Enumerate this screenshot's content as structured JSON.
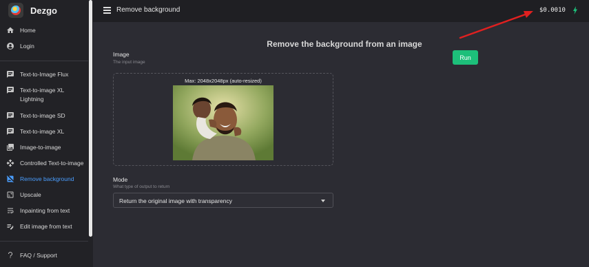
{
  "app": {
    "brand": "Dezgo"
  },
  "sidebar": {
    "items": [
      {
        "label": "Home",
        "icon": "home-icon"
      },
      {
        "label": "Login",
        "icon": "account-circle-icon"
      },
      {
        "label": "Text-to-Image Flux",
        "icon": "text-message-icon"
      },
      {
        "label": "Text-to-image XL Lightning",
        "icon": "text-message-icon"
      },
      {
        "label": "Text-to-image SD",
        "icon": "text-message-icon"
      },
      {
        "label": "Text-to-image XL",
        "icon": "text-message-icon"
      },
      {
        "label": "Image-to-image",
        "icon": "image-stack-icon"
      },
      {
        "label": "Controlled Text-to-image",
        "icon": "move-arrows-icon"
      },
      {
        "label": "Remove background",
        "icon": "hide-image-icon",
        "active": true
      },
      {
        "label": "Upscale",
        "icon": "upscale-icon"
      },
      {
        "label": "Inpainting from text",
        "icon": "wrap-text-icon"
      },
      {
        "label": "Edit image from text",
        "icon": "edit-list-icon"
      },
      {
        "label": "FAQ / Support",
        "icon": "question-mark-icon"
      }
    ]
  },
  "topbar": {
    "title": "Remove background",
    "credits": "$0.0010",
    "credits_icon": "bolt-icon"
  },
  "main": {
    "heading": "Remove the background from an image",
    "image_field": {
      "label": "Image",
      "sublabel": "The input image",
      "max_note": "Max: 2048x2048px (auto-resized)"
    },
    "run_label": "Run",
    "mode_field": {
      "label": "Mode",
      "sublabel": "What type of output to return",
      "selected": "Return the original image with transparency"
    }
  },
  "colors": {
    "accent": "#4a9eff",
    "run_button": "#1dbf7a",
    "bolt": "#1dbf7a",
    "annotation_arrow": "#e02020"
  }
}
